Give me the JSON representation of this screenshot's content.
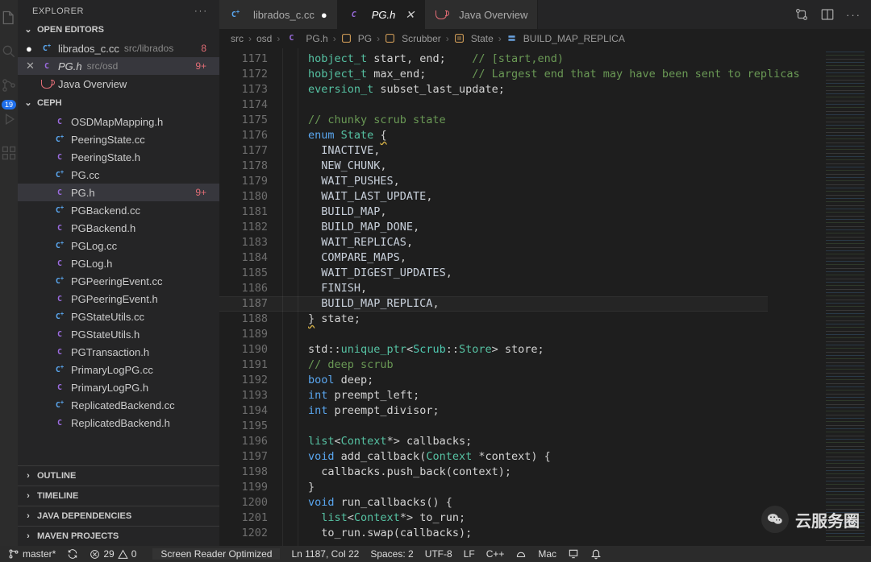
{
  "sidebar": {
    "title": "EXPLORER",
    "sections": {
      "openEditors": {
        "label": "OPEN EDITORS",
        "items": [
          {
            "icon": "cpp",
            "name": "librados_c.cc",
            "path": "src/librados",
            "badge": "8",
            "modified": true,
            "active": false
          },
          {
            "icon": "c",
            "name": "PG.h",
            "path": "src/osd",
            "badge": "9+",
            "modified": false,
            "active": true,
            "italic": true
          },
          {
            "icon": "java",
            "name": "Java Overview",
            "path": "",
            "badge": "",
            "modified": false,
            "active": false
          }
        ]
      },
      "workspace": {
        "label": "CEPH",
        "items": [
          {
            "icon": "c",
            "name": "OSDMapMapping.h"
          },
          {
            "icon": "cpp",
            "name": "PeeringState.cc"
          },
          {
            "icon": "c",
            "name": "PeeringState.h"
          },
          {
            "icon": "cpp",
            "name": "PG.cc"
          },
          {
            "icon": "c",
            "name": "PG.h",
            "badge": "9+",
            "active": true
          },
          {
            "icon": "cpp",
            "name": "PGBackend.cc"
          },
          {
            "icon": "c",
            "name": "PGBackend.h"
          },
          {
            "icon": "cpp",
            "name": "PGLog.cc"
          },
          {
            "icon": "c",
            "name": "PGLog.h"
          },
          {
            "icon": "cpp",
            "name": "PGPeeringEvent.cc"
          },
          {
            "icon": "c",
            "name": "PGPeeringEvent.h"
          },
          {
            "icon": "cpp",
            "name": "PGStateUtils.cc"
          },
          {
            "icon": "c",
            "name": "PGStateUtils.h"
          },
          {
            "icon": "c",
            "name": "PGTransaction.h"
          },
          {
            "icon": "cpp",
            "name": "PrimaryLogPG.cc"
          },
          {
            "icon": "c",
            "name": "PrimaryLogPG.h"
          },
          {
            "icon": "cpp",
            "name": "ReplicatedBackend.cc"
          },
          {
            "icon": "c",
            "name": "ReplicatedBackend.h"
          }
        ]
      },
      "collapsed": [
        "OUTLINE",
        "TIMELINE",
        "JAVA DEPENDENCIES",
        "MAVEN PROJECTS"
      ]
    }
  },
  "tabs": [
    {
      "icon": "cpp",
      "label": "librados_c.cc",
      "active": false,
      "modified": true
    },
    {
      "icon": "c",
      "label": "PG.h",
      "active": true,
      "close": true
    },
    {
      "icon": "java",
      "label": "Java Overview",
      "active": false
    }
  ],
  "breadcrumbs": [
    {
      "label": "src"
    },
    {
      "label": "osd"
    },
    {
      "icon": "c",
      "label": "PG.h"
    },
    {
      "icon": "class",
      "label": "PG"
    },
    {
      "icon": "class",
      "label": "Scrubber"
    },
    {
      "icon": "enum",
      "label": "State"
    },
    {
      "icon": "member",
      "label": "BUILD_MAP_REPLICA"
    }
  ],
  "editor": {
    "firstLine": 1171,
    "highlightLine": 1187,
    "lines": [
      {
        "t": "code",
        "html": "<span class='tok-type'>hobject_t</span> <span class='tok-ident'>start</span>, <span class='tok-ident'>end</span>;    <span class='tok-comment'>// [start,end)</span>"
      },
      {
        "t": "code",
        "html": "<span class='tok-type'>hobject_t</span> <span class='tok-ident'>max_end</span>;       <span class='tok-comment'>// Largest end that may have been sent to replicas</span>"
      },
      {
        "t": "code",
        "html": "<span class='tok-type'>eversion_t</span> <span class='tok-ident'>subset_last_update</span>;"
      },
      {
        "t": "blank",
        "html": ""
      },
      {
        "t": "code",
        "html": "<span class='tok-comment'>// chunky scrub state</span>"
      },
      {
        "t": "code",
        "html": "<span class='tok-kw'>enum</span> <span class='tok-type'>State</span> <span class='tok-squig'>{</span>"
      },
      {
        "t": "code",
        "html": "  <span class='tok-enum'>INACTIVE</span>,"
      },
      {
        "t": "code",
        "html": "  <span class='tok-enum'>NEW_CHUNK</span>,"
      },
      {
        "t": "code",
        "html": "  <span class='tok-enum'>WAIT_PUSHES</span>,"
      },
      {
        "t": "code",
        "html": "  <span class='tok-enum'>WAIT_LAST_UPDATE</span>,"
      },
      {
        "t": "code",
        "html": "  <span class='tok-enum'>BUILD_MAP</span>,"
      },
      {
        "t": "code",
        "html": "  <span class='tok-enum'>BUILD_MAP_DONE</span>,"
      },
      {
        "t": "code",
        "html": "  <span class='tok-enum'>WAIT_REPLICAS</span>,"
      },
      {
        "t": "code",
        "html": "  <span class='tok-enum'>COMPARE_MAPS</span>,"
      },
      {
        "t": "code",
        "html": "  <span class='tok-enum'>WAIT_DIGEST_UPDATES</span>,"
      },
      {
        "t": "code",
        "html": "  <span class='tok-enum'>FINISH</span>,"
      },
      {
        "t": "code",
        "html": "  <span class='tok-enum'>BUILD_MAP_REPLICA</span>,"
      },
      {
        "t": "code",
        "html": "<span class='tok-squig'>}</span> <span class='tok-ident'>state</span>;"
      },
      {
        "t": "blank",
        "html": ""
      },
      {
        "t": "code",
        "html": "<span class='tok-ident'>std</span>::<span class='tok-type'>unique_ptr</span>&lt;<span class='tok-scope'>Scrub</span>::<span class='tok-type'>Store</span>&gt; <span class='tok-ident'>store</span>;"
      },
      {
        "t": "code",
        "html": "<span class='tok-comment'>// deep scrub</span>"
      },
      {
        "t": "code",
        "html": "<span class='tok-kw'>bool</span> <span class='tok-ident'>deep</span>;"
      },
      {
        "t": "code",
        "html": "<span class='tok-kw'>int</span> <span class='tok-ident'>preempt_left</span>;"
      },
      {
        "t": "code",
        "html": "<span class='tok-kw'>int</span> <span class='tok-ident'>preempt_divisor</span>;"
      },
      {
        "t": "blank",
        "html": ""
      },
      {
        "t": "code",
        "html": "<span class='tok-type'>list</span>&lt;<span class='tok-type'>Context</span>*&gt; <span class='tok-ident'>callbacks</span>;"
      },
      {
        "t": "code",
        "html": "<span class='tok-kw'>void</span> <span class='tok-ident'>add_callback</span>(<span class='tok-type'>Context</span> *<span class='tok-ident'>context</span>) {"
      },
      {
        "t": "code",
        "html": "  <span class='tok-ident'>callbacks</span>.<span class='tok-ident'>push_back</span>(<span class='tok-ident'>context</span>);"
      },
      {
        "t": "code",
        "html": "}"
      },
      {
        "t": "code",
        "html": "<span class='tok-kw'>void</span> <span class='tok-ident'>run_callbacks</span>() {"
      },
      {
        "t": "code",
        "html": "  <span class='tok-type'>list</span>&lt;<span class='tok-type'>Context</span>*&gt; <span class='tok-ident'>to_run</span>;"
      },
      {
        "t": "code",
        "html": "  <span class='tok-ident'>to_run</span>.<span class='tok-ident'>swap</span>(<span class='tok-ident'>callbacks</span>);"
      }
    ]
  },
  "status": {
    "branch": "master*",
    "errors": "29",
    "warnings": "0",
    "screenReader": "Screen Reader Optimized",
    "position": "Ln 1187, Col 22",
    "spaces": "Spaces: 2",
    "encoding": "UTF-8",
    "eol": "LF",
    "language": "C++",
    "os": "Mac"
  },
  "activityBadge": "19",
  "watermark": "云服务圈"
}
